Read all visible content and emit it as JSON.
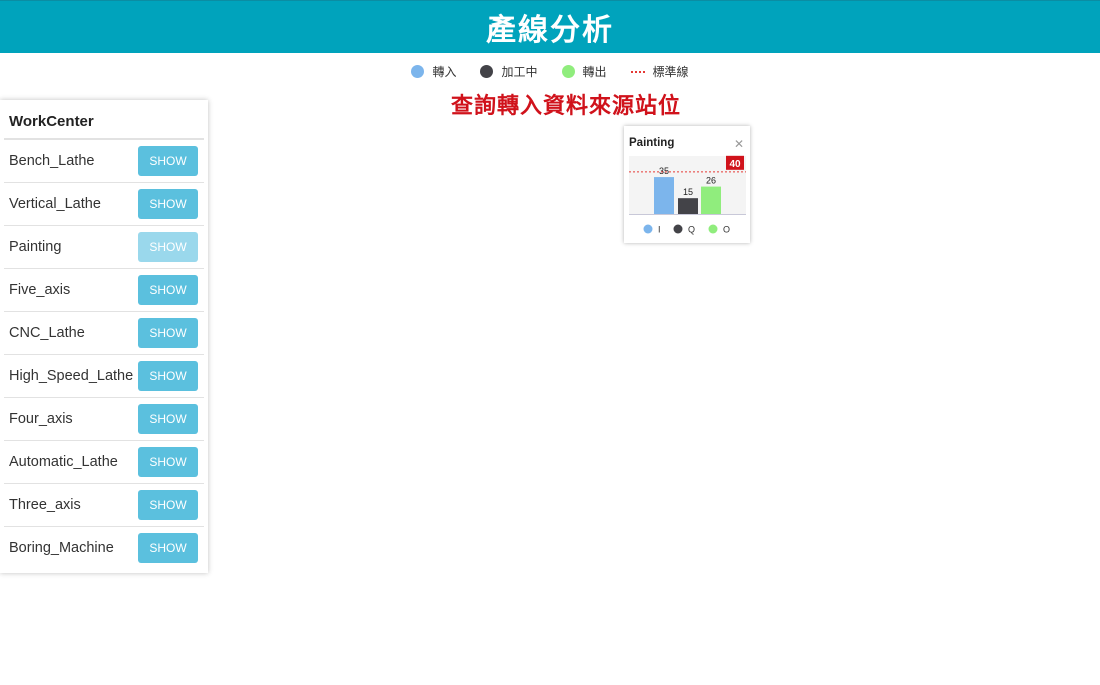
{
  "header": {
    "title": "產線分析"
  },
  "legend": {
    "items": [
      {
        "label": "轉入",
        "color": "#7cb5ec",
        "shape": "dot"
      },
      {
        "label": "加工中",
        "color": "#434348",
        "shape": "dot"
      },
      {
        "label": "轉出",
        "color": "#90ed7d",
        "shape": "dot"
      },
      {
        "label": "標準線",
        "color": "#e53935",
        "shape": "dash"
      }
    ]
  },
  "subtitle": "查詢轉入資料來源站位",
  "panel": {
    "heading": "WorkCenter",
    "button_label": "SHOW",
    "rows": [
      {
        "name": "Bench_Lathe"
      },
      {
        "name": "Vertical_Lathe"
      },
      {
        "name": "Painting"
      },
      {
        "name": "Five_axis"
      },
      {
        "name": "CNC_Lathe"
      },
      {
        "name": "High_Speed_Lathe"
      },
      {
        "name": "Four_axis"
      },
      {
        "name": "Automatic_Lathe"
      },
      {
        "name": "Three_axis"
      },
      {
        "name": "Boring_Machine"
      }
    ]
  },
  "popup": {
    "title": "Painting",
    "close_icon": "close-icon"
  },
  "chart_data": {
    "type": "bar",
    "categories": [
      "I",
      "Q",
      "O"
    ],
    "values": [
      35,
      15,
      26
    ],
    "colors": [
      "#7cb5ec",
      "#434348",
      "#90ed7d"
    ],
    "standard_line": 40,
    "standard_color": "#e53935",
    "ylim": [
      0,
      55
    ],
    "title": "Painting",
    "legend": [
      "I",
      "Q",
      "O"
    ]
  }
}
